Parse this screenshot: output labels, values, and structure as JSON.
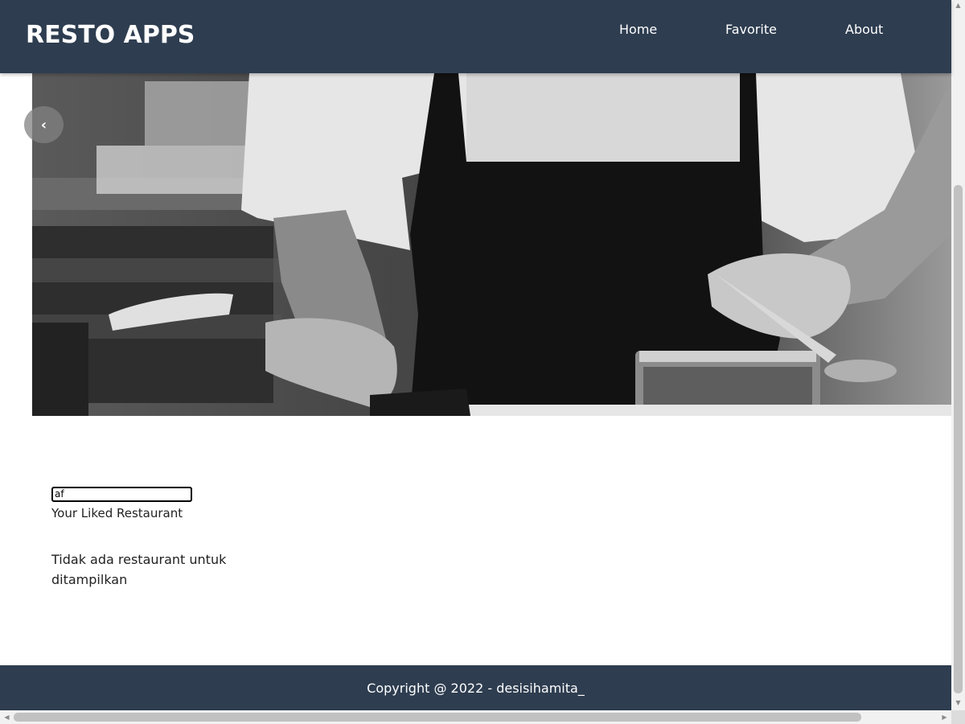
{
  "header": {
    "brand": "RESTO APPS",
    "nav": [
      {
        "label": "Home"
      },
      {
        "label": "Favorite"
      },
      {
        "label": "About"
      }
    ]
  },
  "hero": {
    "image": "chef-plating-food-grayscale",
    "prev_icon": "‹"
  },
  "main": {
    "search_value": "af",
    "liked_title": "Your Liked Restaurant",
    "empty_message": "Tidak ada restaurant untuk ditampilkan"
  },
  "footer": {
    "copyright": "Copyright @ 2022 - desisihamita_"
  },
  "colors": {
    "header_bg": "#2e3d50",
    "footer_bg": "#2e3d50"
  }
}
